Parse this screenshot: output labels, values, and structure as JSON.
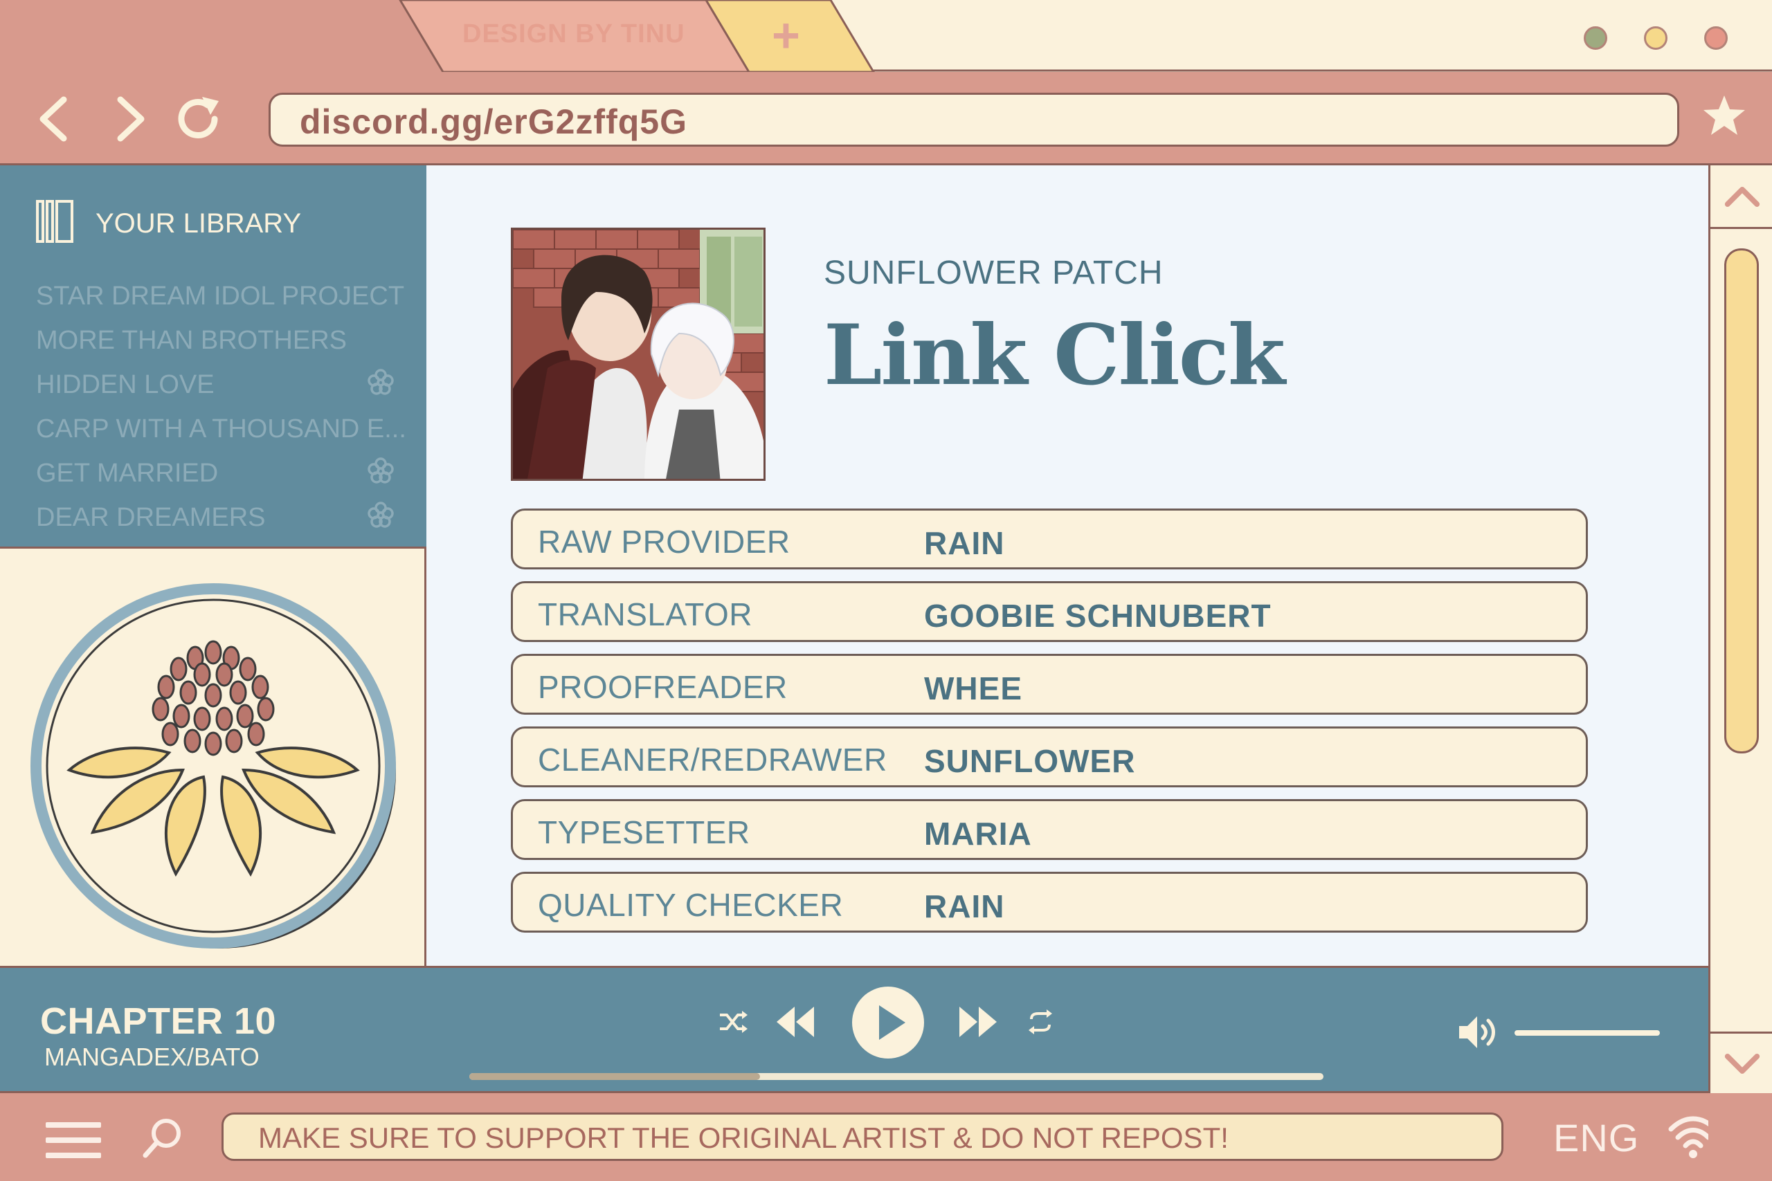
{
  "window": {
    "tab_label": "DESIGN BY TINU",
    "new_tab_symbol": "+",
    "dots": [
      "minimize-dot",
      "maximize-dot",
      "close-dot"
    ]
  },
  "nav": {
    "url": "discord.gg/erG2zffq5G",
    "icons": [
      "back-arrow-icon",
      "forward-arrow-icon",
      "reload-icon",
      "star-icon"
    ]
  },
  "sidebar": {
    "title": "YOUR LIBRARY",
    "items": [
      {
        "label": "STAR DREAM IDOL PROJECT",
        "flower": false
      },
      {
        "label": "MORE THAN BROTHERS",
        "flower": false
      },
      {
        "label": "HIDDEN LOVE",
        "flower": true
      },
      {
        "label": "CARP WITH A THOUSAND E...",
        "flower": false
      },
      {
        "label": "GET MARRIED",
        "flower": true
      },
      {
        "label": "DEAR DREAMERS",
        "flower": true
      }
    ]
  },
  "main": {
    "group_name": "SUNFLOWER PATCH",
    "series_title": "Link Click",
    "credits": [
      {
        "role": "RAW PROVIDER",
        "name": "RAIN"
      },
      {
        "role": "TRANSLATOR",
        "name": "GOOBIE SCHNUBERT"
      },
      {
        "role": "PROOFREADER",
        "name": "WHEE"
      },
      {
        "role": "CLEANER/REDRAWER",
        "name": "SUNFLOWER"
      },
      {
        "role": "TYPESETTER",
        "name": "MARIA"
      },
      {
        "role": "QUALITY CHECKER",
        "name": "RAIN"
      }
    ]
  },
  "player": {
    "chapter": "CHAPTER 10",
    "source": "MANGADEX/BATO",
    "progress_fraction": 0.34,
    "volume_fraction": 1.0
  },
  "status": {
    "notice": "MAKE SURE TO SUPPORT THE ORIGINAL ARTIST & DO NOT REPOST!",
    "language": "ENG"
  },
  "colors": {
    "frame": "#d89a8d",
    "cream": "#fbf2dc",
    "teal": "#618c9e",
    "content_bg": "#f1f6fb",
    "outline": "#8a5f57",
    "sunflower_yellow": "#f6d98a"
  }
}
